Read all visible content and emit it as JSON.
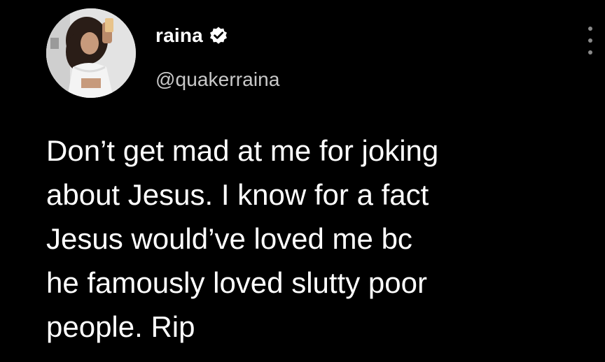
{
  "tweet": {
    "author": {
      "display_name": "raina",
      "handle": "@quakerraina",
      "verified": true,
      "verified_icon": "verified-badge-icon",
      "avatar_icon": "profile-photo"
    },
    "menu_icon": "more-options-icon",
    "text_lines": [
      "Don’t get mad at me for joking",
      "about Jesus. I know for a fact",
      "Jesus would’ve loved me bc",
      "he famously loved slutty poor",
      "people. Rip"
    ]
  },
  "colors": {
    "background": "#000000",
    "text": "#ffffff",
    "handle": "#c9c9c9",
    "verified_badge": "#ffffff"
  }
}
